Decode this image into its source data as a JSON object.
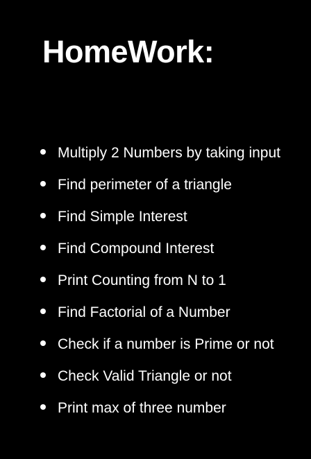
{
  "title": "HomeWork:",
  "tasks": [
    "Multiply 2 Numbers by taking input",
    "Find perimeter of a triangle",
    "Find Simple Interest",
    "Find Compound Interest",
    "Print Counting from N to 1",
    "Find Factorial of a Number",
    "Check if a number is Prime or not",
    "Check Valid Triangle or not",
    "Print max of three number"
  ]
}
